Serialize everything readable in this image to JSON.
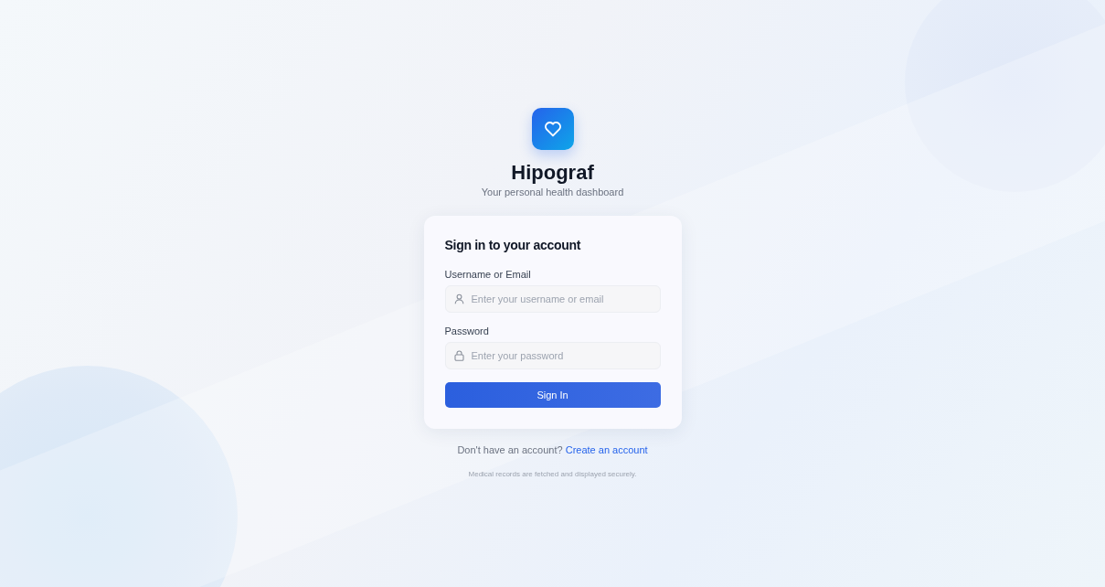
{
  "app": {
    "name": "Hipograf",
    "tagline": "Your personal health dashboard"
  },
  "form": {
    "title": "Sign in to your account",
    "fields": [
      {
        "kind": "user",
        "label": "Username or Email",
        "placeholder": "Enter your username or email"
      },
      {
        "kind": "password",
        "label": "Password",
        "placeholder": "Enter your password"
      }
    ],
    "submit": "Sign In"
  },
  "signup": {
    "prompt": "Don't have an account?",
    "link": "Create an account"
  },
  "note": "Medical records are fetched and displayed securely."
}
